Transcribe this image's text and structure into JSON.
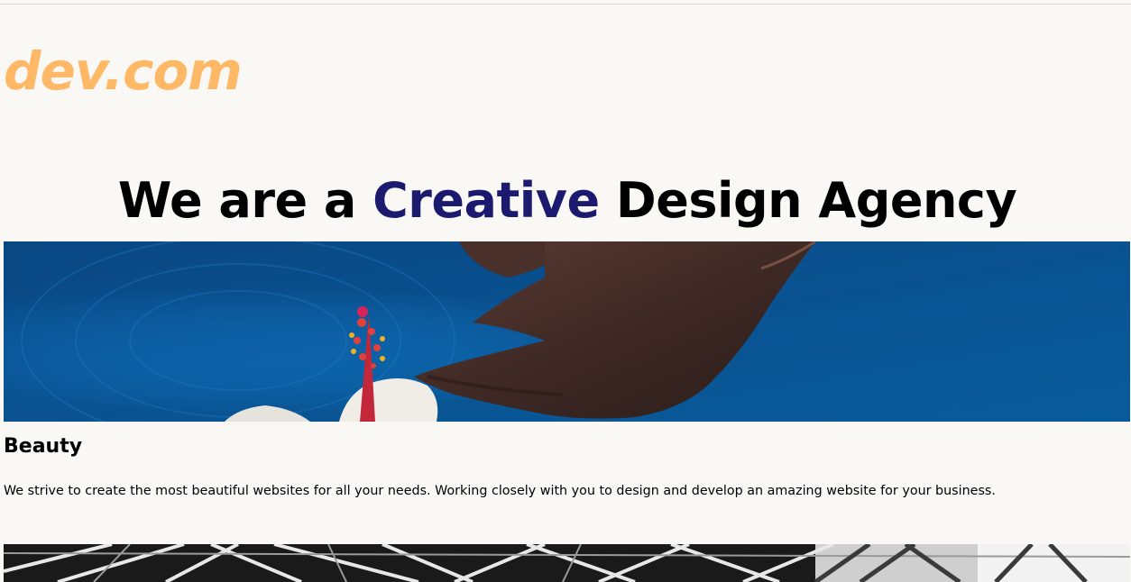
{
  "brand": {
    "logo_text": "dev.com",
    "logo_color": "#ffb866"
  },
  "hero": {
    "headline_before": "We are a ",
    "headline_accent": "Creative",
    "headline_after": " Design Agency",
    "accent_color": "#1b1a6f",
    "image_subject": "hand-touching-water-with-flower-image"
  },
  "sections": [
    {
      "title": "Beauty",
      "text": "We strive to create the most beautiful websites for all your needs. Working closely with you to design and develop an amazing website for your business."
    }
  ],
  "next_image": {
    "image_subject": "steel-structure-black-and-white-image"
  },
  "colors": {
    "background": "#f9f8f5",
    "water_blue": "#0a6eb0",
    "text": "#000000"
  }
}
